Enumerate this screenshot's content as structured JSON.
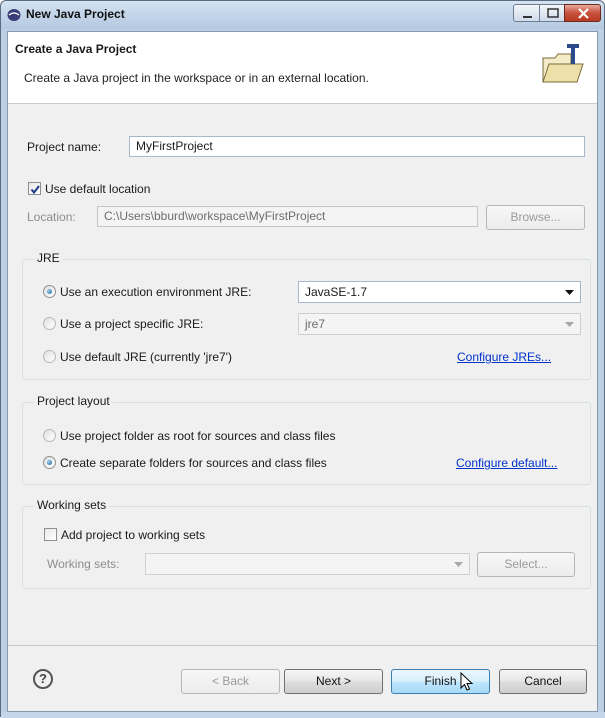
{
  "window": {
    "title": "New Java Project"
  },
  "header": {
    "title": "Create a Java Project",
    "description": "Create a Java project in the workspace or in an external location."
  },
  "project": {
    "name_label": "Project name:",
    "name_value": "MyFirstProject",
    "use_default_location_label": "Use default location",
    "use_default_location_checked": true,
    "location_label": "Location:",
    "location_value": "C:\\Users\\bburd\\workspace\\MyFirstProject",
    "browse_label": "Browse..."
  },
  "jre": {
    "group_title": "JRE",
    "option_exec_env_label": "Use an execution environment JRE:",
    "exec_env_value": "JavaSE-1.7",
    "option_project_specific_label": "Use a project specific JRE:",
    "project_specific_value": "jre7",
    "option_default_label": "Use default JRE (currently 'jre7')",
    "configure_link": "Configure JREs...",
    "selected": "execution environment"
  },
  "layout": {
    "group_title": "Project layout",
    "option_root_label": "Use project folder as root for sources and class files",
    "option_separate_label": "Create separate folders for sources and class files",
    "configure_link": "Configure default...",
    "selected": "separate folders"
  },
  "working_sets": {
    "group_title": "Working sets",
    "add_label": "Add project to working sets",
    "add_checked": false,
    "sets_label": "Working sets:",
    "sets_value": "",
    "select_label": "Select..."
  },
  "buttons": {
    "help": "?",
    "back": "< Back",
    "next": "Next >",
    "finish": "Finish",
    "cancel": "Cancel"
  },
  "icons": {
    "app": "java-coffee-icon",
    "wizard": "folder-wizard-icon",
    "cursor": "mouse-pointer-icon"
  },
  "colors": {
    "link": "#0033cc",
    "title_bar": "#c4d6ea",
    "close_button": "#c8513c",
    "radio_fill": "#1a5f96"
  }
}
